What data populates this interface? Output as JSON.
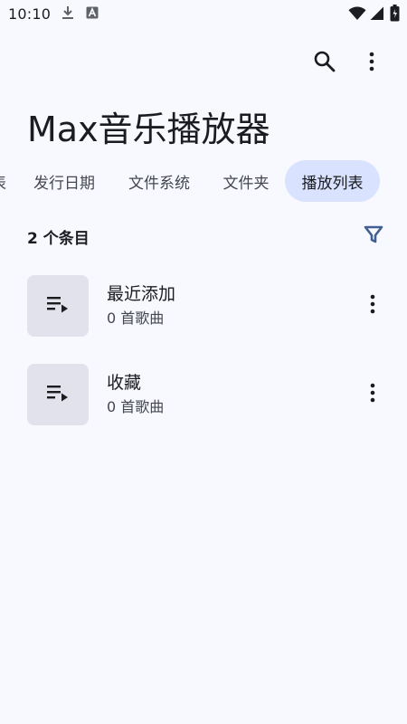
{
  "status_bar": {
    "time": "10:10",
    "icons": [
      "download-icon",
      "font-app-icon",
      "wifi-icon",
      "cellular-icon",
      "battery-icon"
    ]
  },
  "toolbar": {
    "icons": [
      "search-icon",
      "more-vert-icon"
    ]
  },
  "app_title": "Max音乐播放器",
  "tabs": [
    {
      "label": "表"
    },
    {
      "label": "发行日期"
    },
    {
      "label": "文件系统"
    },
    {
      "label": "文件夹"
    },
    {
      "label": "播放列表",
      "active": true
    }
  ],
  "list_header": {
    "count_label": "2 个条目",
    "filter_icon": "filter-icon"
  },
  "playlists": [
    {
      "title": "最近添加",
      "subtitle": "0 首歌曲",
      "icon": "playlist-play-icon"
    },
    {
      "title": "收藏",
      "subtitle": "0 首歌曲",
      "icon": "playlist-play-icon"
    }
  ],
  "colors": {
    "background": "#f8f9ff",
    "active_tab": "#d9e2ff",
    "thumbnail": "#e1e2ec",
    "filter_icon": "#415f91",
    "text_primary": "#1a1c20",
    "text_secondary": "#44474f"
  }
}
